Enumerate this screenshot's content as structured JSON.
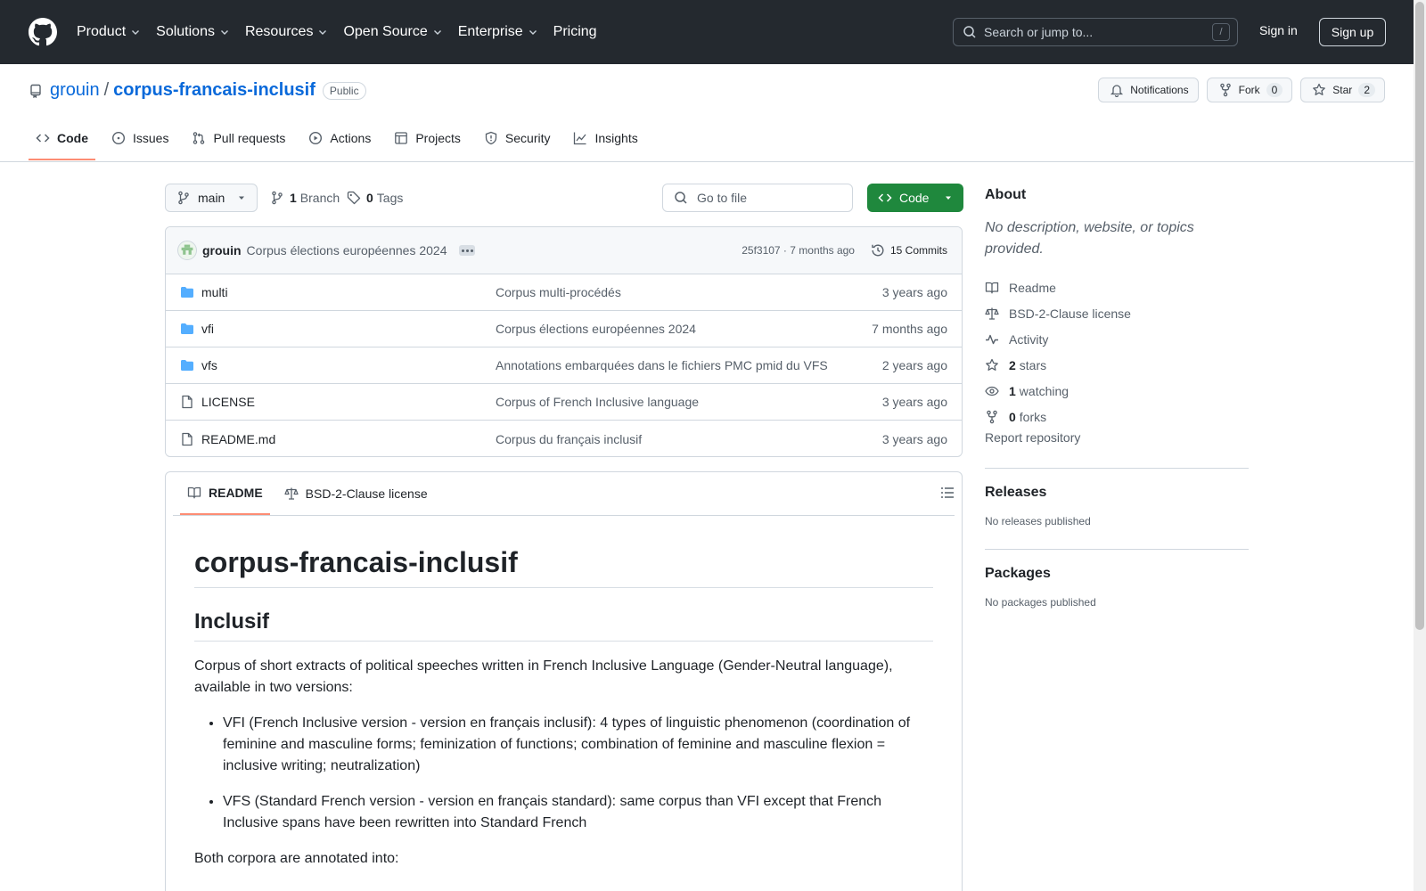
{
  "header": {
    "nav": [
      {
        "label": "Product"
      },
      {
        "label": "Solutions"
      },
      {
        "label": "Resources"
      },
      {
        "label": "Open Source"
      },
      {
        "label": "Enterprise"
      },
      {
        "label": "Pricing"
      }
    ],
    "search_placeholder": "Search or jump to...",
    "search_shortcut": "/",
    "sign_in": "Sign in",
    "sign_up": "Sign up"
  },
  "repo": {
    "owner": "grouin",
    "separator": "/",
    "name": "corpus-francais-inclusif",
    "visibility": "Public",
    "notifications_label": "Notifications",
    "fork_label": "Fork",
    "fork_count": "0",
    "star_label": "Star",
    "star_count": "2",
    "tabs": [
      {
        "label": "Code"
      },
      {
        "label": "Issues"
      },
      {
        "label": "Pull requests"
      },
      {
        "label": "Actions"
      },
      {
        "label": "Projects"
      },
      {
        "label": "Security"
      },
      {
        "label": "Insights"
      }
    ]
  },
  "filenav": {
    "branch": "main",
    "branch_count": "1",
    "branch_label": "Branch",
    "tag_count": "0",
    "tag_label": "Tags",
    "goto_placeholder": "Go to file",
    "code_label": "Code"
  },
  "commit": {
    "author": "grouin",
    "message": "Corpus élections européennes 2024",
    "meta": "25f3107 · 7 months ago",
    "commits_label": "15 Commits"
  },
  "files": [
    {
      "name": "multi",
      "type": "folder",
      "message": "Corpus multi-procédés",
      "age": "3 years ago"
    },
    {
      "name": "vfi",
      "type": "folder",
      "message": "Corpus élections européennes 2024",
      "age": "7 months ago"
    },
    {
      "name": "vfs",
      "type": "folder",
      "message": "Annotations embarquées dans le fichiers PMC pmid du VFS",
      "age": "2 years ago"
    },
    {
      "name": "LICENSE",
      "type": "file",
      "message": "Corpus of French Inclusive language",
      "age": "3 years ago"
    },
    {
      "name": "README.md",
      "type": "file",
      "message": "Corpus du français inclusif",
      "age": "3 years ago"
    }
  ],
  "readme": {
    "tab_readme": "README",
    "tab_license": "BSD-2-Clause license",
    "h1": "corpus-francais-inclusif",
    "h2": "Inclusif",
    "intro": "Corpus of short extracts of political speeches written in French Inclusive Language (Gender-Neutral language), available in two versions:",
    "bullets": [
      "VFI (French Inclusive version - version en français inclusif): 4 types of linguistic phenomenon (coordination of feminine and masculine forms; feminization of functions; combination of feminine and masculine flexion = inclusive writing; neutralization)",
      "VFS (Standard French version - version en français standard): same corpus than VFI except that French Inclusive spans have been rewritten into Standard French"
    ],
    "outro": "Both corpora are annotated into:"
  },
  "about": {
    "title": "About",
    "description": "No description, website, or topics provided.",
    "readme": "Readme",
    "license": "BSD-2-Clause license",
    "activity": "Activity",
    "stars_count": "2",
    "stars_label": "stars",
    "watching_count": "1",
    "watching_label": "watching",
    "forks_count": "0",
    "forks_label": "forks",
    "report": "Report repository"
  },
  "releases": {
    "title": "Releases",
    "text": "No releases published"
  },
  "packages": {
    "title": "Packages",
    "text": "No packages published"
  },
  "colors": {
    "header_bg": "#24292f",
    "link": "#0969da",
    "code_button": "#1f883d",
    "tab_underline": "#fd8c73",
    "folder": "#54aeff"
  }
}
